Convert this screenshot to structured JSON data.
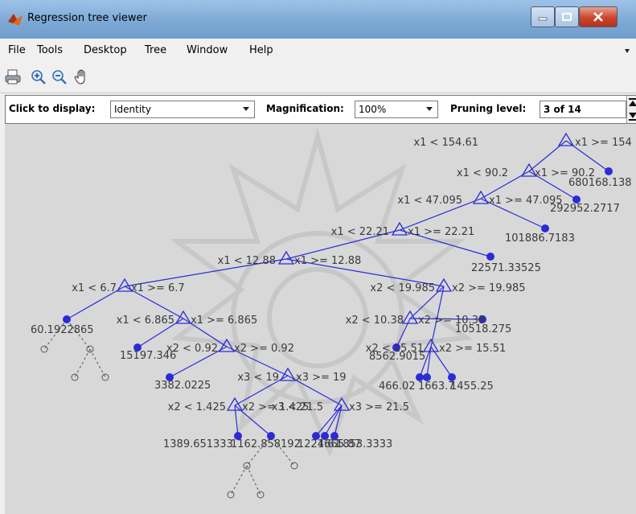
{
  "window": {
    "title": "Regression tree viewer"
  },
  "menu": [
    "File",
    "Tools",
    "Desktop",
    "Tree",
    "Window",
    "Help"
  ],
  "controls": {
    "click_label": "Click to display:",
    "click_value": "Identity",
    "mag_label": "Magnification:",
    "mag_value": "100%",
    "prune_label": "Pruning level:",
    "prune_value": "3 of 14"
  },
  "tree": {
    "splits": [
      {
        "left": "x1 < 154.61",
        "right": "x1 >= 154"
      },
      {
        "left": "x1 < 90.2",
        "right": "x1 >= 90.2"
      },
      {
        "left": "x1 < 47.095",
        "right": "x1 >= 47.095"
      },
      {
        "left": "x1 < 22.21",
        "right": "x1 >= 22.21"
      },
      {
        "left": "x1 < 12.88",
        "right": "x1 >= 12.88"
      },
      {
        "left": "x1 < 6.7",
        "right": "x1 >= 6.7"
      },
      {
        "left": "x1 < 6.865",
        "right": "x1 >= 6.865"
      },
      {
        "left": "x2 < 0.92",
        "right": "x2 >= 0.92"
      },
      {
        "left": "x3 < 19",
        "right": "x3 >= 19"
      },
      {
        "left": "x2 < 1.425",
        "right": "x2 >= 1.425"
      },
      {
        "left": "x3 < 21.5",
        "right": "x3 >= 21.5"
      },
      {
        "left": "x2 < 19.985",
        "right": "x2 >= 19.985"
      },
      {
        "left": "x2 < 10.38",
        "right": "x2 >= 10.38"
      },
      {
        "left": "x2 < 15.51",
        "right": "x2 >= 15.51"
      }
    ],
    "leaves": [
      "680168.138",
      "292952.2717",
      "101886.7183",
      "22571.33525",
      "60.1922865",
      "15197.346",
      "3382.0225",
      "1389.651333",
      "1162.858192",
      "1224.61",
      "1665.87",
      "1853.3333",
      "10518.275",
      "8562.9015",
      "466.02",
      "1663.7",
      "1455.25"
    ]
  }
}
